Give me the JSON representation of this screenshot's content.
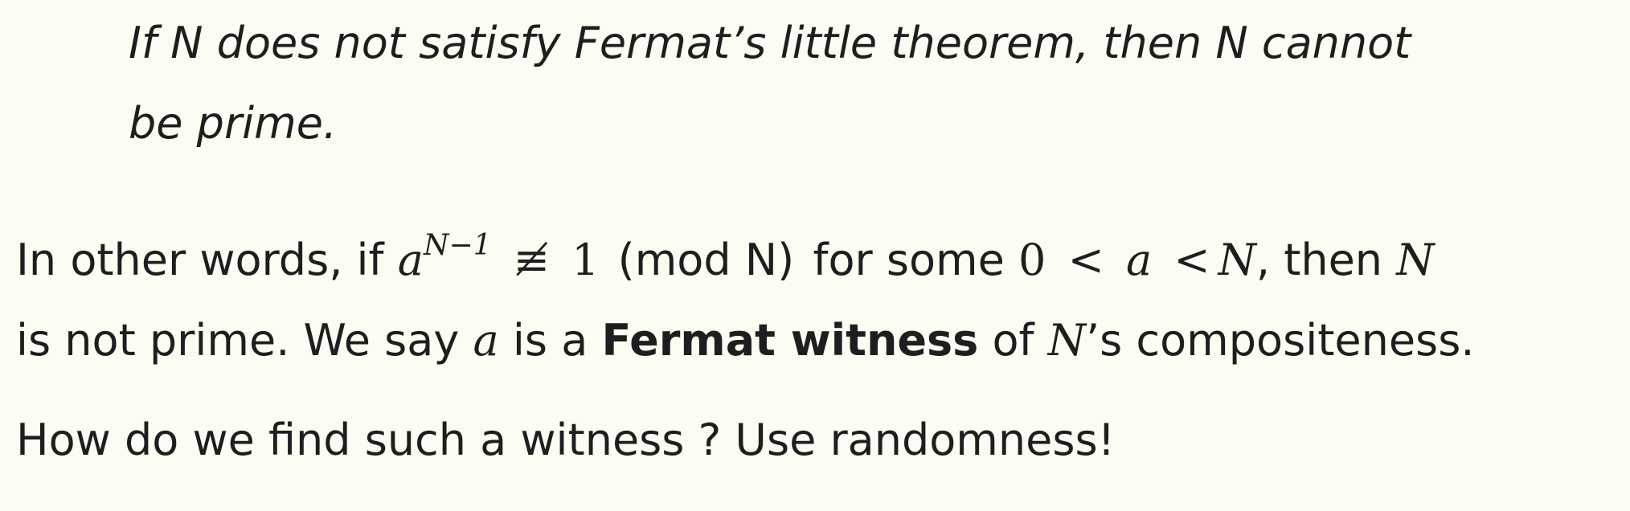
{
  "statement": {
    "line1": "If N does not satisfy Fermat’s little theorem, then N cannot",
    "line2": "be prime."
  },
  "paragraph1": {
    "t1": "In other words, if",
    "base": "a",
    "exponent": "N−1",
    "notequiv": "≢",
    "one": "1",
    "mod": "(mod N)",
    "t2": "for some",
    "zero": "0",
    "lt1": "<",
    "a2": "a",
    "lt2": "<",
    "N1": "N",
    "t3": ", then",
    "N2": "N",
    "line2_t1": "is not prime. We say",
    "line2_a": "a",
    "line2_t2": "is a",
    "line2_bold": "Fermat witness",
    "line2_t3": "of",
    "line2_N": "N",
    "line2_t4": "’s compositeness."
  },
  "paragraph2": {
    "text": "How do we find such a witness ? Use randomness!"
  }
}
